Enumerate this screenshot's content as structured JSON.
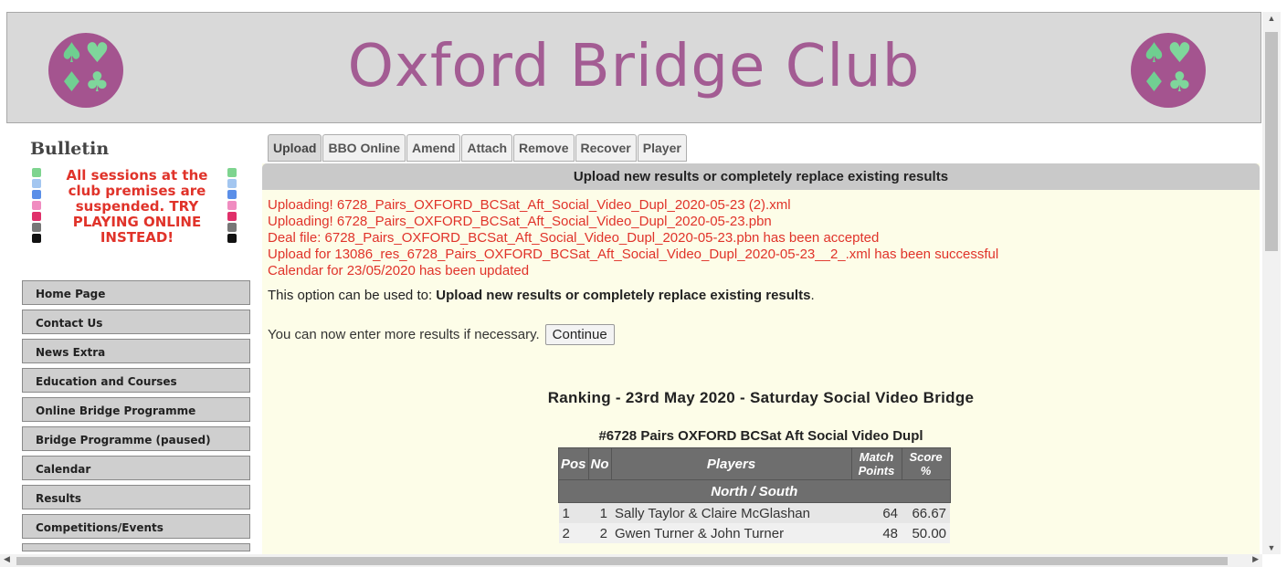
{
  "header": {
    "title": "Oxford Bridge Club",
    "logo_suits": [
      "♠",
      "♥",
      "♦",
      "♣"
    ]
  },
  "sidebar": {
    "bulletin_title": "Bulletin",
    "bulletin_text": "All sessions at the club premises are suspended. TRY PLAYING ONLINE INSTEAD!",
    "bar_colors": [
      "#7ed48f",
      "#a3c6f0",
      "#5b8fe8",
      "#f08cc0",
      "#e0306a",
      "#777777",
      "#111111"
    ],
    "items": [
      {
        "label": "Home Page"
      },
      {
        "label": "Contact Us"
      },
      {
        "label": "News Extra"
      },
      {
        "label": "Education and Courses"
      },
      {
        "label": "Online Bridge Programme"
      },
      {
        "label": "Bridge Programme (paused)"
      },
      {
        "label": "Calendar"
      },
      {
        "label": "Results"
      },
      {
        "label": "Competitions/Events"
      }
    ]
  },
  "tabs": [
    "Upload",
    "BBO Online",
    "Amend",
    "Attach",
    "Remove",
    "Recover",
    "Player"
  ],
  "active_tab": "Upload",
  "panel": {
    "heading": "Upload new results or completely replace existing results",
    "messages": [
      "Uploading! 6728_Pairs_OXFORD_BCSat_Aft_Social_Video_Dupl_2020-05-23 (2).xml",
      "Uploading! 6728_Pairs_OXFORD_BCSat_Aft_Social_Video_Dupl_2020-05-23.pbn",
      "Deal file: 6728_Pairs_OXFORD_BCSat_Aft_Social_Video_Dupl_2020-05-23.pbn has been accepted",
      "Upload for 13086_res_6728_Pairs_OXFORD_BCSat_Aft_Social_Video_Dupl_2020-05-23__2_.xml has been successful",
      "Calendar for 23/05/2020 has been updated"
    ],
    "option_prefix": "This option can be used to: ",
    "option_bold": "Upload new results or completely replace existing results",
    "option_suffix": ".",
    "more_text": "You can now enter more results if necessary.",
    "continue_label": "Continue",
    "ranking_title": "Ranking - 23rd May 2020 - Saturday Social Video Bridge",
    "event_title": "#6728 Pairs OXFORD BCSat Aft Social Video Dupl"
  },
  "results_table": {
    "headers": {
      "pos": "Pos",
      "no": "No",
      "players": "Players",
      "match_points": "Match Points",
      "score": "Score %"
    },
    "section": "North / South",
    "rows": [
      {
        "pos": "1",
        "no": "1",
        "players": "Sally Taylor & Claire McGlashan",
        "match_points": "64",
        "score": "66.67"
      },
      {
        "pos": "2",
        "no": "2",
        "players": "Gwen Turner & John Turner",
        "match_points": "48",
        "score": "50.00"
      }
    ]
  }
}
